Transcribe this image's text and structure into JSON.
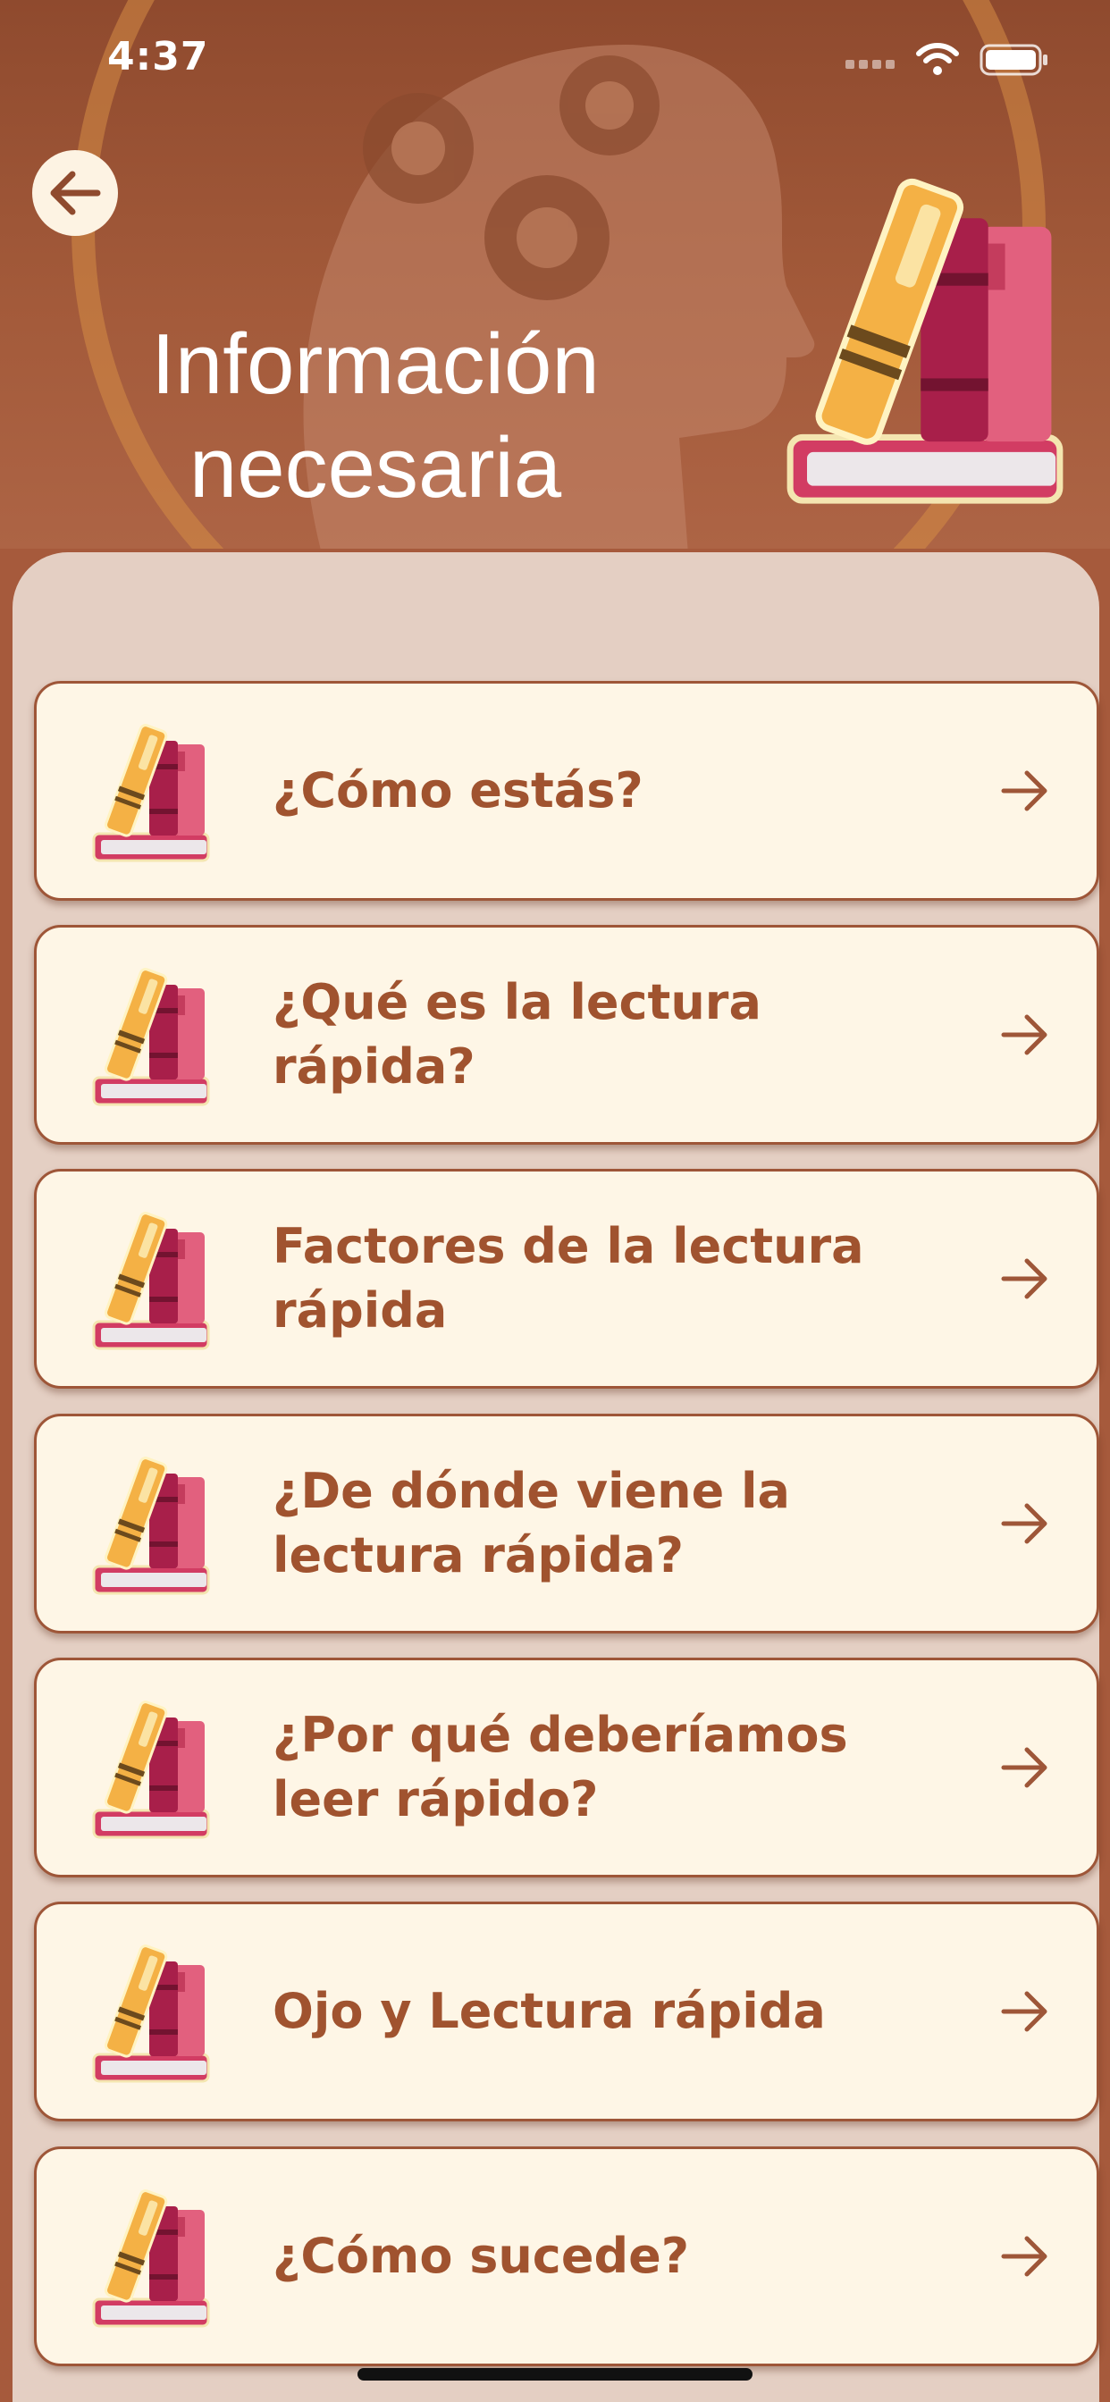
{
  "status_bar": {
    "time": "4:37",
    "icons": [
      "signal-icon",
      "wifi-icon",
      "battery-icon"
    ]
  },
  "header": {
    "title": "Información\nnecesaria",
    "back_icon": "arrow-left-icon",
    "illustration_icon": "books-icon"
  },
  "list": {
    "items": [
      {
        "label": "¿Cómo estás?",
        "icon": "books-icon",
        "arrow": "arrow-right-icon"
      },
      {
        "label": "¿Qué es la lectura\nrápida?",
        "icon": "books-icon",
        "arrow": "arrow-right-icon"
      },
      {
        "label": "Factores de la lectura\nrápida",
        "icon": "books-icon",
        "arrow": "arrow-right-icon"
      },
      {
        "label": "¿De dónde viene la\nlectura rápida?",
        "icon": "books-icon",
        "arrow": "arrow-right-icon"
      },
      {
        "label": "¿Por qué deberíamos\nleer rápido?",
        "icon": "books-icon",
        "arrow": "arrow-right-icon"
      },
      {
        "label": "Ojo y Lectura rápida",
        "icon": "books-icon",
        "arrow": "arrow-right-icon"
      },
      {
        "label": "¿Cómo sucede?",
        "icon": "books-icon",
        "arrow": "arrow-right-icon"
      }
    ]
  },
  "colors": {
    "header_bg": "#a35a3a",
    "panel_bg": "#e4cfc3",
    "card_bg": "#fef6e6",
    "card_border": "#9e5638",
    "text_accent": "#a0532f"
  }
}
